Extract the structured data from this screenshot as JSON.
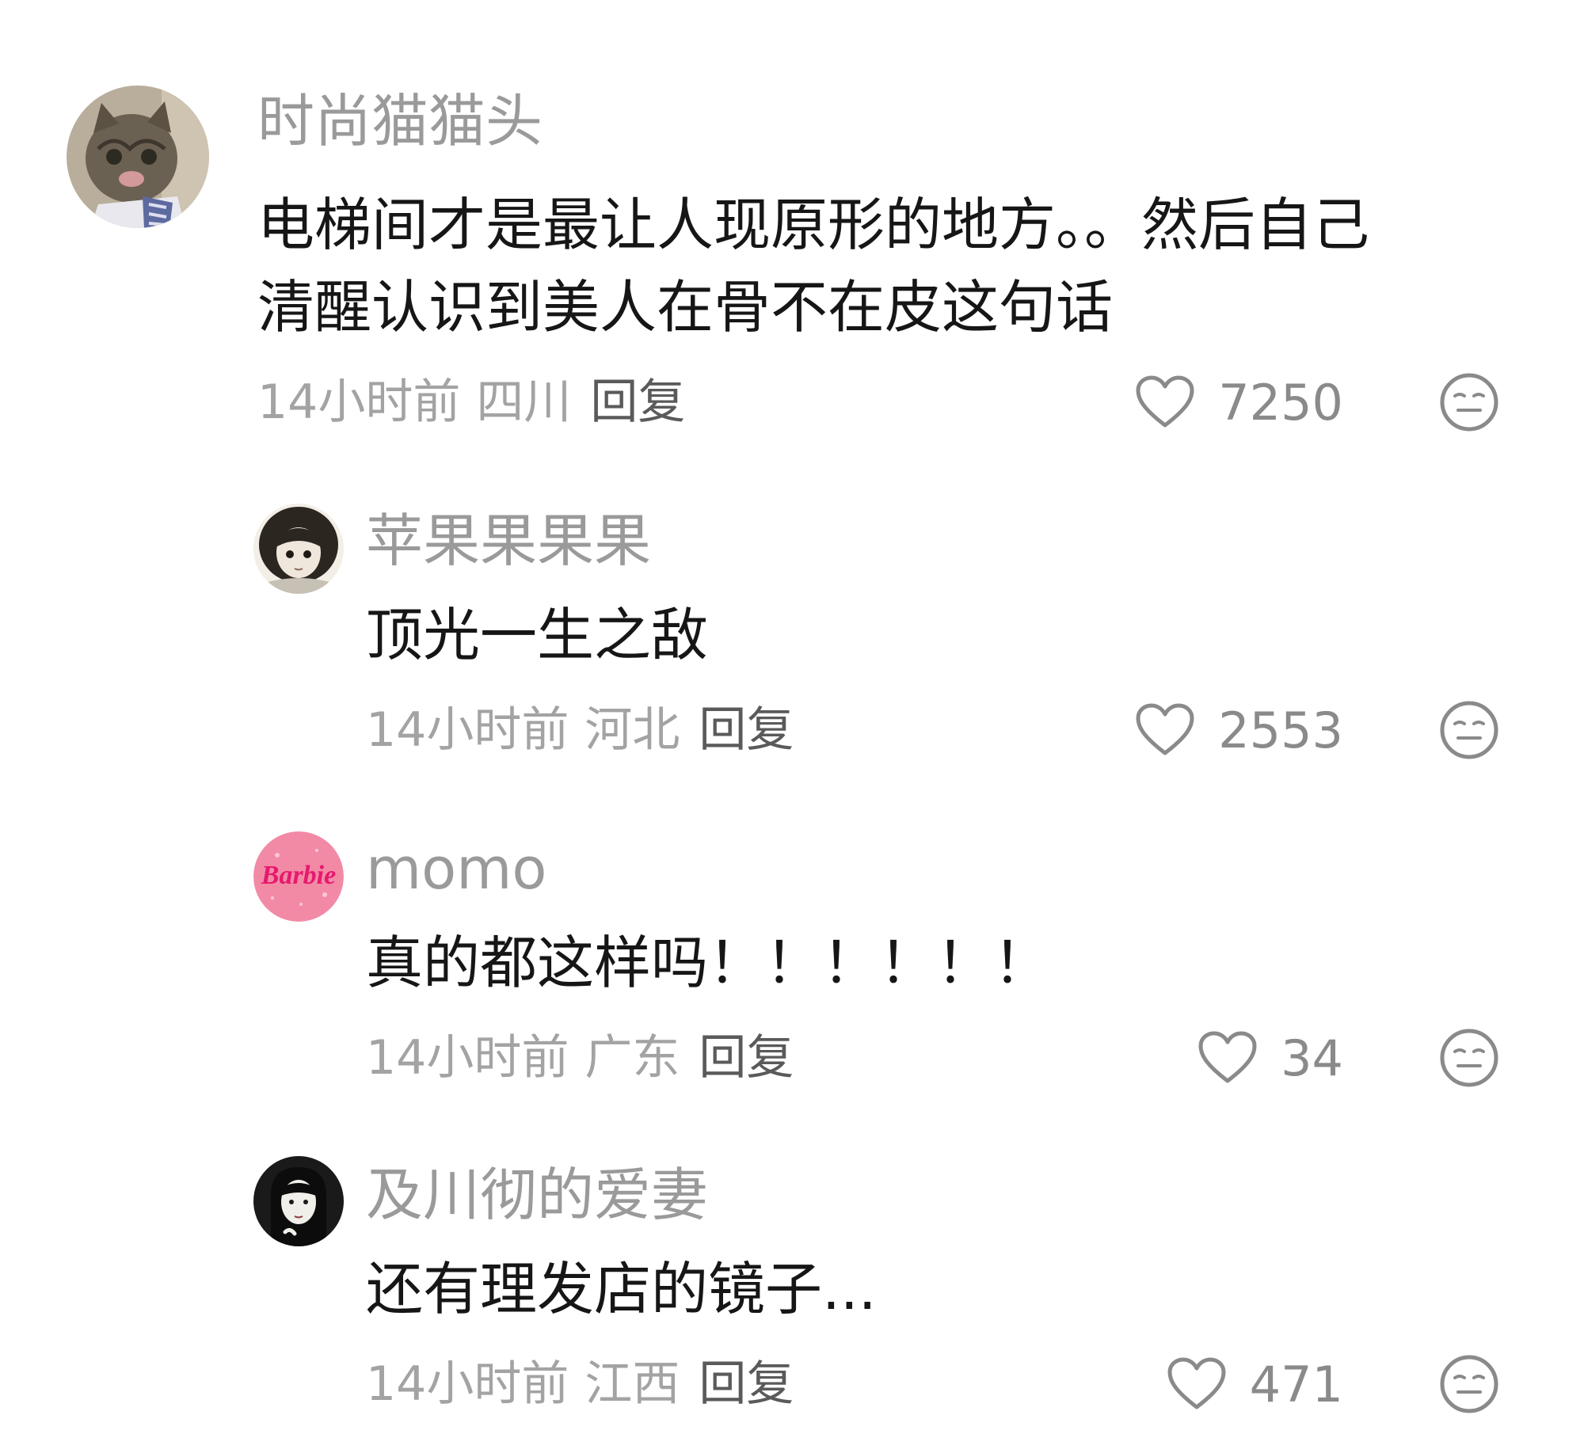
{
  "comments": [
    {
      "username": "时尚猫猫头",
      "text_lines": [
        "电梯间才是最让人现原形的地方。。然后自己",
        "清醒认识到美人在骨不在皮这句话"
      ],
      "time": "14小时前",
      "region": "四川",
      "reply_label": "回复",
      "likes": "7250",
      "avatar_icon": "cat-avatar"
    },
    {
      "username": "苹果果果果",
      "text_lines": [
        "顶光一生之敌"
      ],
      "time": "14小时前",
      "region": "河北",
      "reply_label": "回复",
      "likes": "2553",
      "avatar_icon": "anime-girl-avatar"
    },
    {
      "username": "momo",
      "text_lines": [
        "真的都这样吗！！！！！！"
      ],
      "time": "14小时前",
      "region": "广东",
      "reply_label": "回复",
      "likes": "34",
      "avatar_icon": "barbie-avatar",
      "avatar_text": "Barbie"
    },
    {
      "username": "及川彻的爱妻",
      "text_lines": [
        "还有理发店的镜子..."
      ],
      "time": "14小时前",
      "region": "江西",
      "reply_label": "回复",
      "likes": "471",
      "avatar_icon": "dark-hair-girl-avatar"
    }
  ],
  "colors": {
    "username": "#9a9a9a",
    "body_text": "#161616",
    "meta": "#a3a3a3",
    "reply": "#5a5a5a",
    "icon": "#8a8a8a",
    "barbie_pink": "#f28aa6"
  }
}
